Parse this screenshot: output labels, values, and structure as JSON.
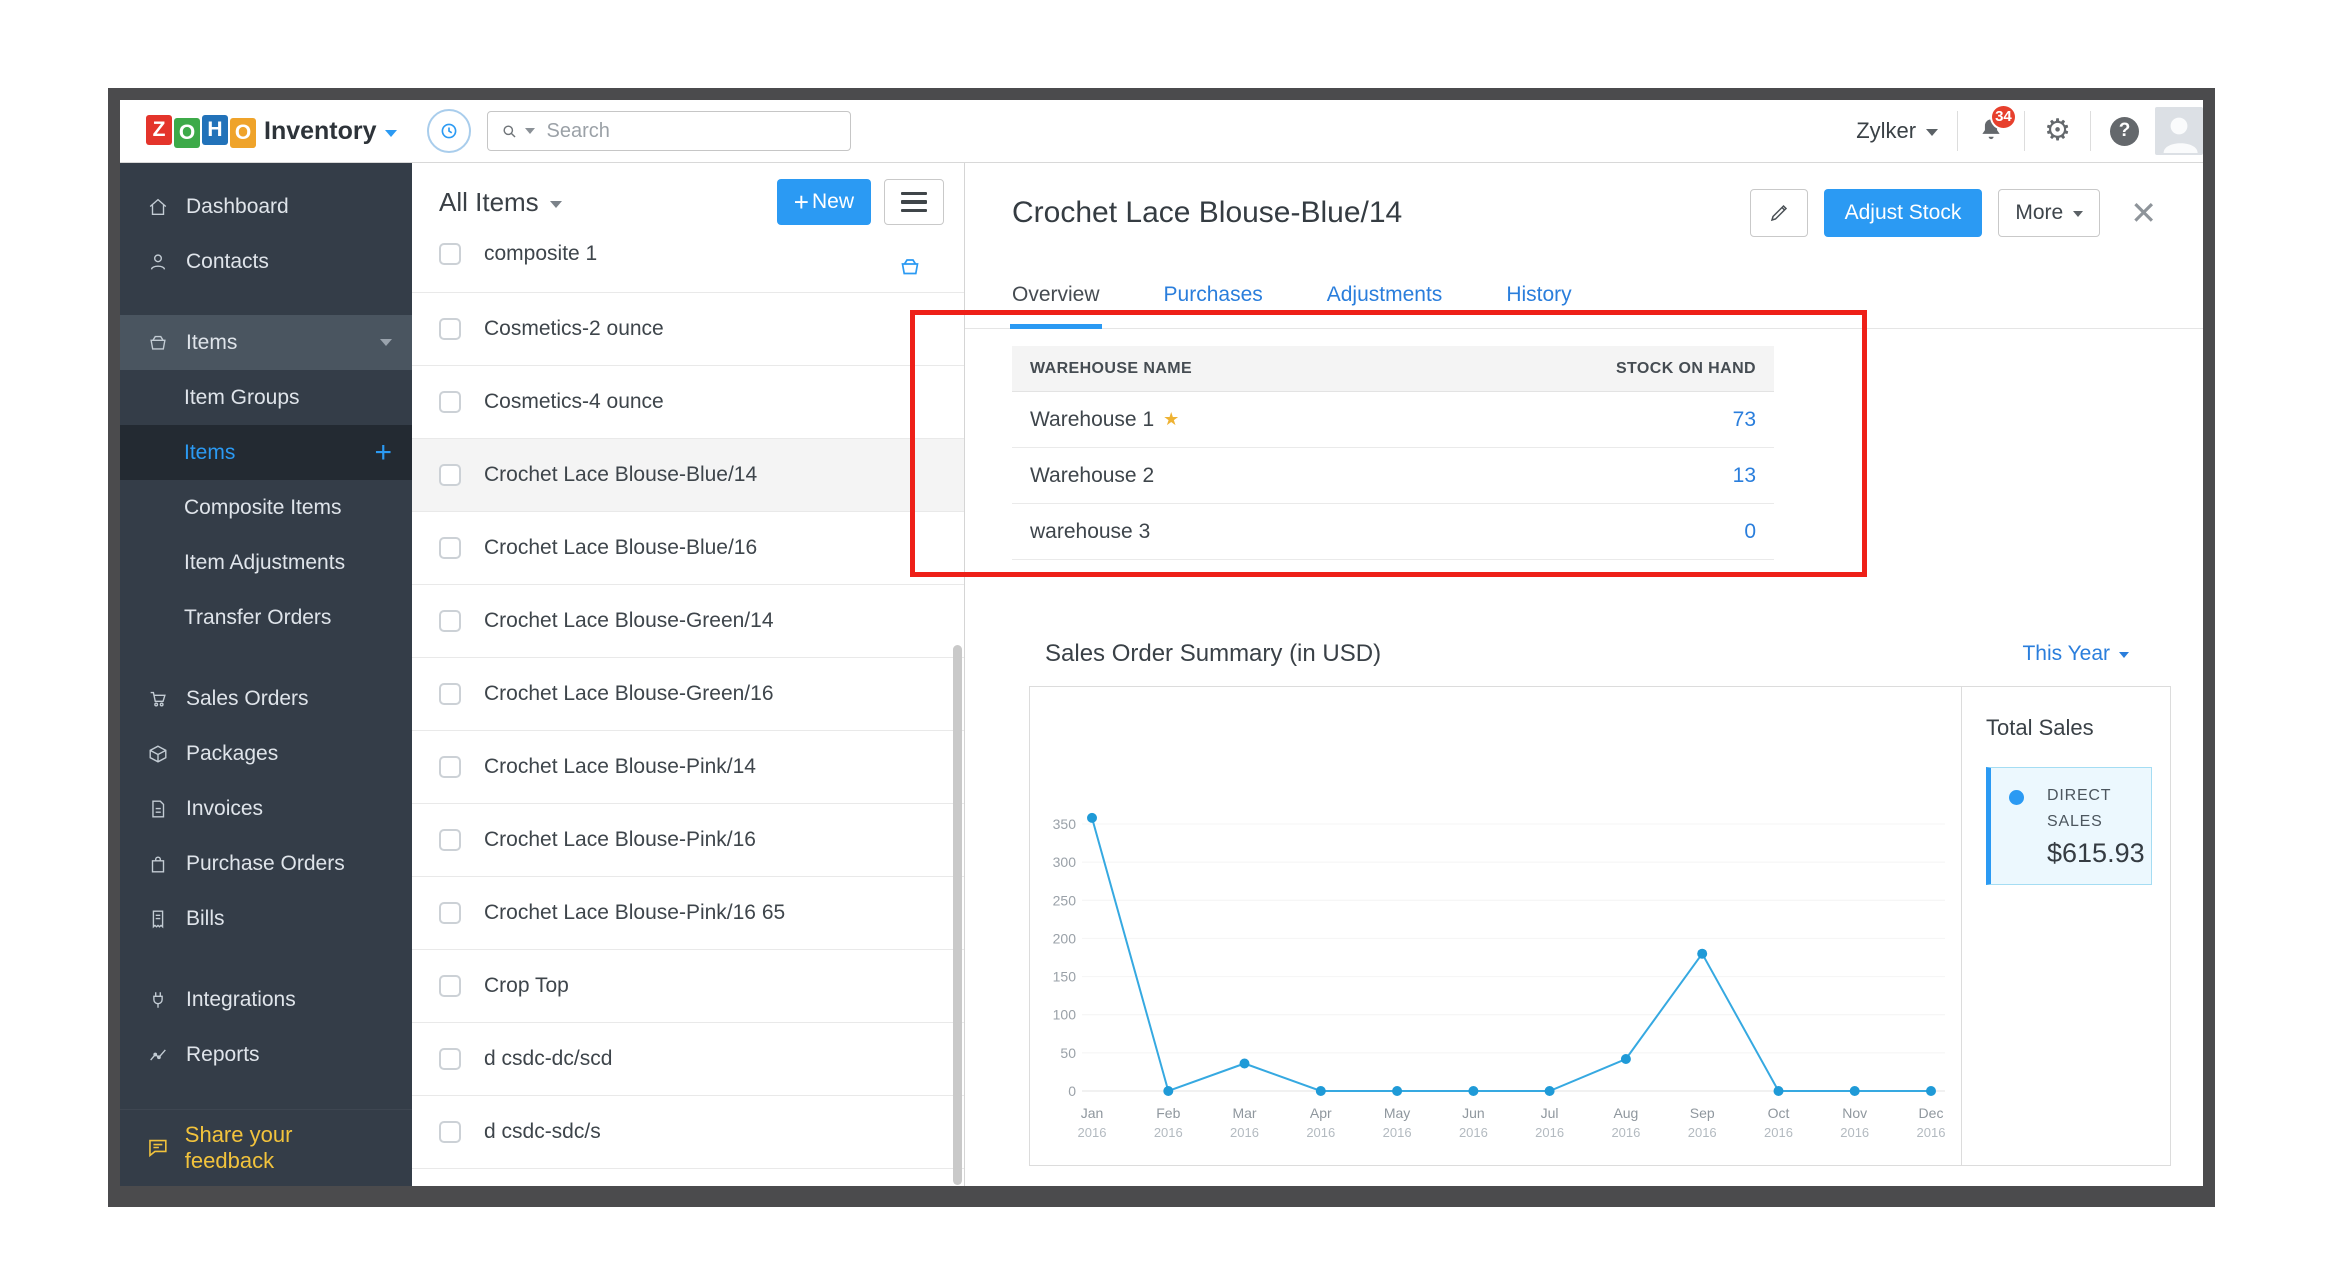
{
  "colors": {
    "accent": "#2b9af3",
    "link": "#2a7edc",
    "annotation": "#ee2018",
    "chart_line": "#36a9e1",
    "chart_dot": "#1f9ad7",
    "star": "#eeb233",
    "feedback_yellow": "#f2c33c"
  },
  "topbar": {
    "brand_letters": [
      {
        "ch": "Z",
        "bg": "#e4342b"
      },
      {
        "ch": "O",
        "bg": "#3daa49"
      },
      {
        "ch": "H",
        "bg": "#2272b9"
      },
      {
        "ch": "O",
        "bg": "#efa32a"
      }
    ],
    "brand_product": "Inventory",
    "search_placeholder": "Search",
    "org_name": "Zylker",
    "notification_count": "34"
  },
  "sidebar": {
    "items": [
      {
        "label": "Dashboard",
        "icon": "home",
        "type": "item"
      },
      {
        "label": "Contacts",
        "icon": "user",
        "type": "item",
        "gap_after": true
      },
      {
        "label": "Items",
        "icon": "basket",
        "type": "parent",
        "trailing": "caret",
        "active": true
      },
      {
        "label": "Item Groups",
        "type": "sub"
      },
      {
        "label": "Items",
        "type": "sub",
        "active": true,
        "trailing": "plus"
      },
      {
        "label": "Composite Items",
        "type": "sub"
      },
      {
        "label": "Item Adjustments",
        "type": "sub"
      },
      {
        "label": "Transfer Orders",
        "type": "sub",
        "gap_after": true
      },
      {
        "label": "Sales Orders",
        "icon": "cart",
        "type": "item"
      },
      {
        "label": "Packages",
        "icon": "package",
        "type": "item"
      },
      {
        "label": "Invoices",
        "icon": "file",
        "type": "item"
      },
      {
        "label": "Purchase Orders",
        "icon": "bag",
        "type": "item"
      },
      {
        "label": "Bills",
        "icon": "receipt",
        "type": "item",
        "gap_after": true
      },
      {
        "label": "Integrations",
        "icon": "plug",
        "type": "item"
      },
      {
        "label": "Reports",
        "icon": "chartline",
        "type": "item"
      }
    ],
    "feedback": {
      "label": "Share your feedback",
      "icon": "chat"
    }
  },
  "list": {
    "filter_label": "All Items",
    "new_label": "New",
    "items": [
      {
        "name": "composite 1",
        "cut": true,
        "icon": "basket"
      },
      {
        "name": "Cosmetics-2 ounce"
      },
      {
        "name": "Cosmetics-4 ounce"
      },
      {
        "name": "Crochet Lace Blouse-Blue/14",
        "selected": true
      },
      {
        "name": "Crochet Lace Blouse-Blue/16"
      },
      {
        "name": "Crochet Lace Blouse-Green/14"
      },
      {
        "name": "Crochet Lace Blouse-Green/16"
      },
      {
        "name": "Crochet Lace Blouse-Pink/14"
      },
      {
        "name": "Crochet Lace Blouse-Pink/16"
      },
      {
        "name": "Crochet Lace Blouse-Pink/16 65"
      },
      {
        "name": "Crop Top"
      },
      {
        "name": "d csdc-dc/scd"
      },
      {
        "name": "d csdc-sdc/s"
      }
    ]
  },
  "detail": {
    "title": "Crochet Lace Blouse-Blue/14",
    "buttons": {
      "adjust_stock": "Adjust Stock",
      "more": "More"
    },
    "tabs": [
      {
        "label": "Overview",
        "active": true
      },
      {
        "label": "Purchases"
      },
      {
        "label": "Adjustments"
      },
      {
        "label": "History"
      }
    ],
    "warehouse_table": {
      "columns": [
        "WAREHOUSE NAME",
        "STOCK ON HAND"
      ],
      "rows": [
        {
          "name": "Warehouse 1",
          "primary": true,
          "stock": "73"
        },
        {
          "name": "Warehouse 2",
          "stock": "13"
        },
        {
          "name": "warehouse 3",
          "stock": "0"
        }
      ]
    },
    "sales_summary": {
      "title": "Sales Order Summary (in USD)",
      "period": "This Year"
    }
  },
  "chart_data": {
    "type": "line",
    "title": "Sales Order Summary (in USD)",
    "x_labels": [
      "Jan",
      "Feb",
      "Mar",
      "Apr",
      "May",
      "Jun",
      "Jul",
      "Aug",
      "Sep",
      "Oct",
      "Nov",
      "Dec"
    ],
    "year": "2016",
    "values": [
      358,
      0,
      36,
      0,
      0,
      0,
      0,
      42,
      180,
      0,
      0,
      0
    ],
    "ylim": [
      0,
      350
    ],
    "yticks": [
      0,
      50,
      100,
      150,
      200,
      250,
      300,
      350
    ],
    "grid": true,
    "legend_position": "right",
    "total_sales_label": "Total Sales",
    "series_label": "DIRECT SALES",
    "total_value": "$615.93"
  }
}
